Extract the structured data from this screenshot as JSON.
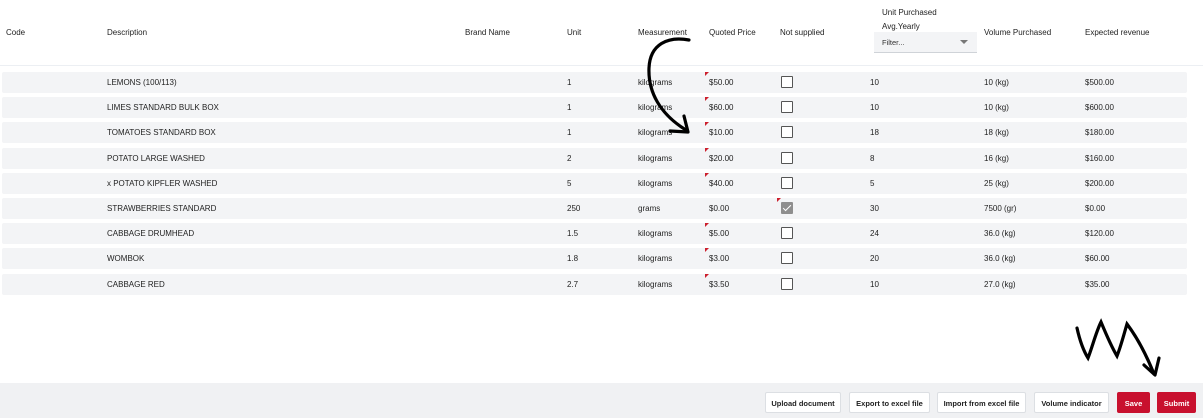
{
  "headers": {
    "code": "Code",
    "description": "Description",
    "brand_name": "Brand Name",
    "unit": "Unit",
    "measurement": "Measurement",
    "quoted_price": "Quoted Price",
    "not_supplied": "Not supplied",
    "unit_purchased_line1": "Unit Purchased",
    "unit_purchased_line2": "Avg.Yearly",
    "volume_purchased": "Volume Purchased",
    "expected_revenue": "Expected revenue"
  },
  "filter": {
    "placeholder": "Filter..."
  },
  "rows": [
    {
      "description": "LEMONS (100/113)",
      "unit": "1",
      "measurement": "kilograms",
      "quoted_price": "$50.00",
      "not_supplied": false,
      "unit_purchased": "10",
      "volume": "10 (kg)",
      "revenue": "$500.00"
    },
    {
      "description": "LIMES STANDARD BULK BOX",
      "unit": "1",
      "measurement": "kilograms",
      "quoted_price": "$60.00",
      "not_supplied": false,
      "unit_purchased": "10",
      "volume": "10 (kg)",
      "revenue": "$600.00"
    },
    {
      "description": "TOMATOES STANDARD BOX",
      "unit": "1",
      "measurement": "kilograms",
      "quoted_price": "$10.00",
      "not_supplied": false,
      "unit_purchased": "18",
      "volume": "18 (kg)",
      "revenue": "$180.00"
    },
    {
      "description": "POTATO LARGE WASHED",
      "unit": "2",
      "measurement": "kilograms",
      "quoted_price": "$20.00",
      "not_supplied": false,
      "unit_purchased": "8",
      "volume": "16 (kg)",
      "revenue": "$160.00"
    },
    {
      "description": "x POTATO KIPFLER WASHED",
      "unit": "5",
      "measurement": "kilograms",
      "quoted_price": "$40.00",
      "not_supplied": false,
      "unit_purchased": "5",
      "volume": "25 (kg)",
      "revenue": "$200.00"
    },
    {
      "description": "STRAWBERRIES STANDARD",
      "unit": "250",
      "measurement": "grams",
      "quoted_price": "$0.00",
      "not_supplied": true,
      "unit_purchased": "30",
      "volume": "7500 (gr)",
      "revenue": "$0.00"
    },
    {
      "description": "CABBAGE DRUMHEAD",
      "unit": "1.5",
      "measurement": "kilograms",
      "quoted_price": "$5.00",
      "not_supplied": false,
      "unit_purchased": "24",
      "volume": "36.0 (kg)",
      "revenue": "$120.00"
    },
    {
      "description": "WOMBOK",
      "unit": "1.8",
      "measurement": "kilograms",
      "quoted_price": "$3.00",
      "not_supplied": false,
      "unit_purchased": "20",
      "volume": "36.0 (kg)",
      "revenue": "$60.00"
    },
    {
      "description": "CABBAGE RED",
      "unit": "2.7",
      "measurement": "kilograms",
      "quoted_price": "$3.50",
      "not_supplied": false,
      "unit_purchased": "10",
      "volume": "27.0 (kg)",
      "revenue": "$35.00"
    }
  ],
  "footer": {
    "upload_label": "Upload document",
    "export_label": "Export to excel file",
    "import_label": "Import from excel file",
    "volume_label": "Volume indicator",
    "save_label": "Save",
    "submit_label": "Submit"
  },
  "colors": {
    "accent": "#c8102e",
    "row_bg": "#f3f4f6",
    "flag": "#cc1f2d"
  }
}
